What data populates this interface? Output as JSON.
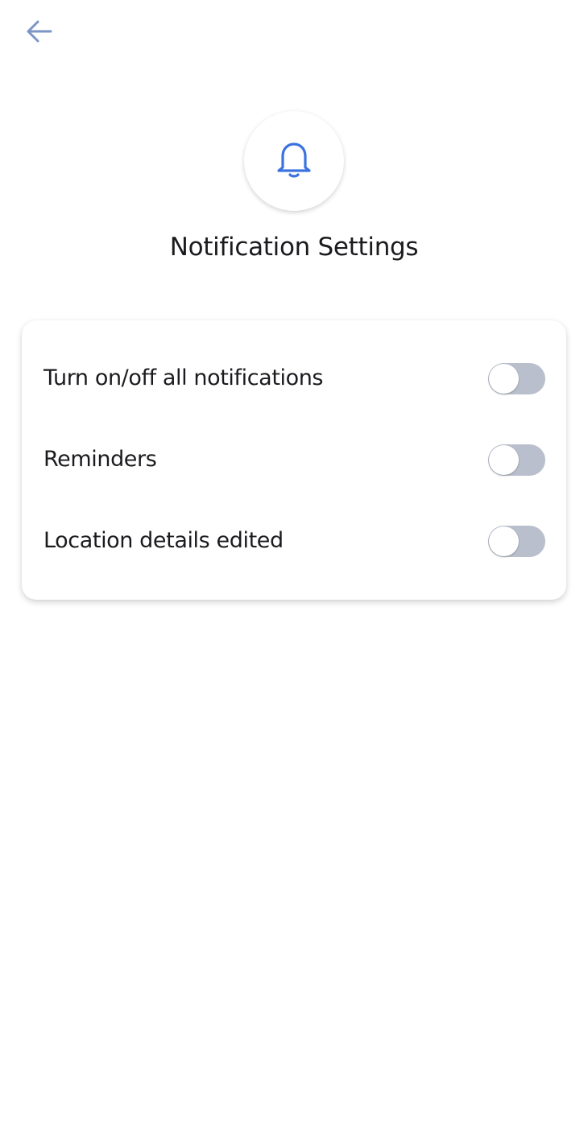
{
  "header": {
    "back_icon": "arrow-left-icon"
  },
  "hero": {
    "icon": "bell-icon",
    "title": "Notification Settings"
  },
  "colors": {
    "accent": "#3b73e0",
    "back_arrow": "#7b95c4",
    "toggle_off_track": "#b9bfcc"
  },
  "settings": [
    {
      "label": "Turn on/off all notifications",
      "enabled": false
    },
    {
      "label": "Reminders",
      "enabled": false
    },
    {
      "label": "Location details edited",
      "enabled": false
    }
  ]
}
